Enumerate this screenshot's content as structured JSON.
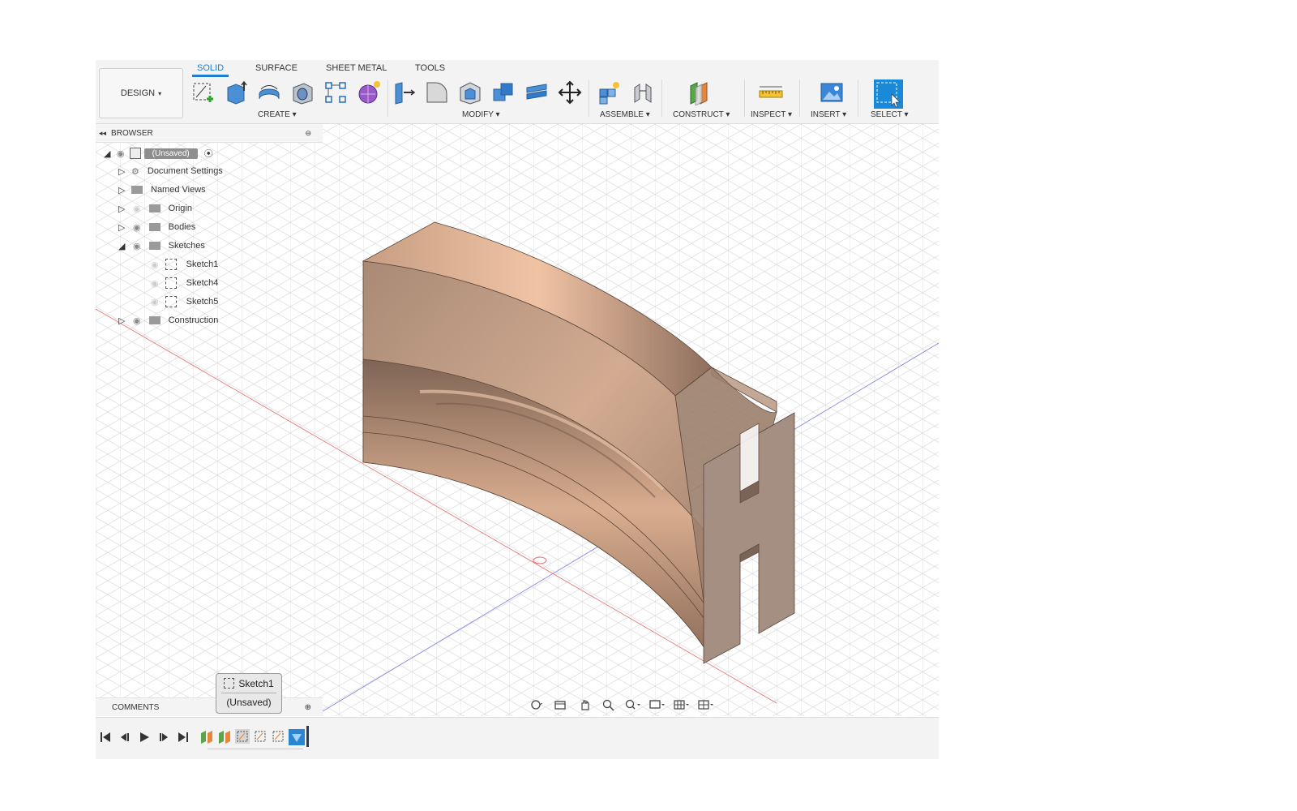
{
  "toolbar": {
    "workspace": "DESIGN",
    "tabs": [
      {
        "label": "SOLID",
        "active": true
      },
      {
        "label": "SURFACE",
        "active": false
      },
      {
        "label": "SHEET METAL",
        "active": false
      },
      {
        "label": "TOOLS",
        "active": false
      }
    ],
    "groups": {
      "create": "CREATE",
      "modify": "MODIFY",
      "assemble": "ASSEMBLE",
      "construct": "CONSTRUCT",
      "inspect": "INSPECT",
      "insert": "INSERT",
      "select": "SELECT"
    },
    "accent": "#1f7ed1"
  },
  "browser": {
    "title": "BROWSER",
    "root": "(Unsaved)",
    "items": [
      {
        "label": "Document Settings",
        "icon": "gear-icon"
      },
      {
        "label": "Named Views",
        "icon": "folder-icon"
      },
      {
        "label": "Origin",
        "icon": "folder-icon"
      },
      {
        "label": "Bodies",
        "icon": "folder-icon"
      },
      {
        "label": "Sketches",
        "icon": "folder-icon",
        "expanded": true
      },
      {
        "label": "Sketch1",
        "icon": "sketch-icon"
      },
      {
        "label": "Sketch4",
        "icon": "sketch-icon"
      },
      {
        "label": "Sketch5",
        "icon": "sketch-icon"
      },
      {
        "label": "Construction",
        "icon": "folder-icon"
      }
    ]
  },
  "comments": {
    "title": "COMMENTS"
  },
  "tooltip": {
    "name": "Sketch1",
    "state": "(Unsaved)"
  },
  "model": {
    "color": "#b49480"
  }
}
